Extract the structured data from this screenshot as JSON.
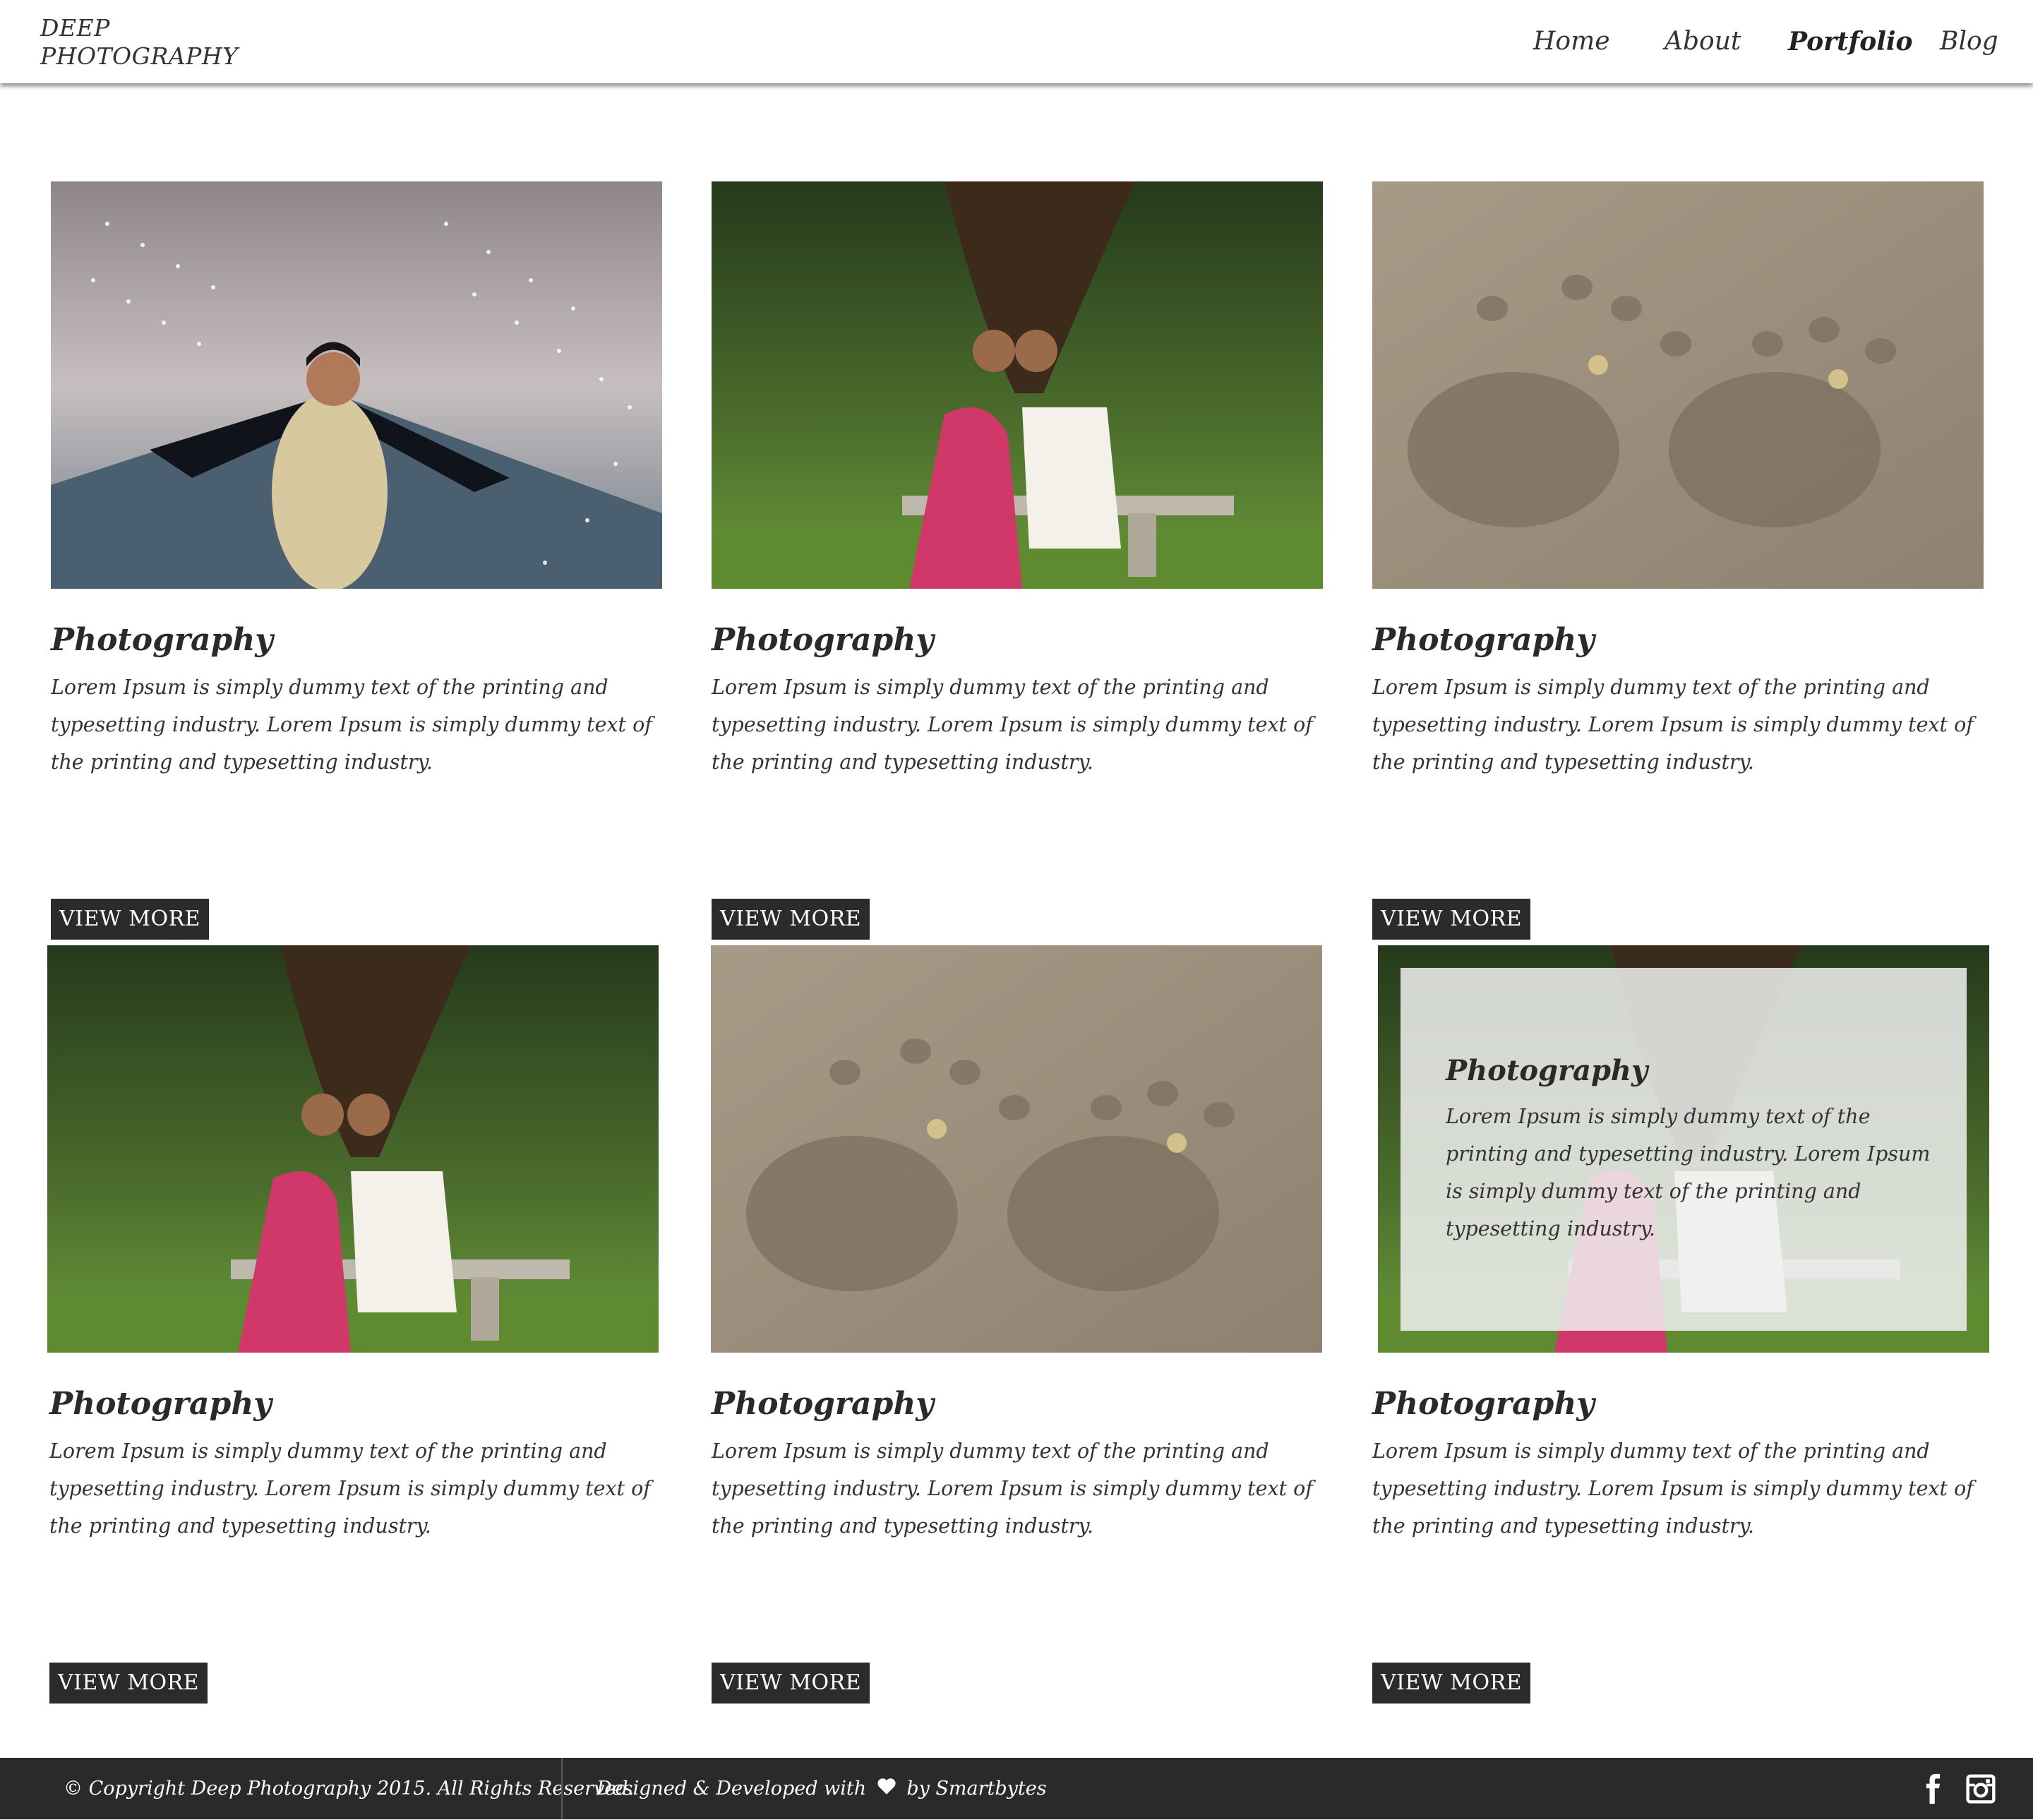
{
  "brand": {
    "logo_line1": "DEEP",
    "logo_line2": "PHOTOGRAPHY"
  },
  "nav": {
    "items": [
      {
        "label": "Home"
      },
      {
        "label": "About"
      },
      {
        "label": "Portfolio",
        "active": true
      },
      {
        "label": "Blog"
      }
    ]
  },
  "cards": [
    {
      "title": "Photography",
      "text": "Lorem Ipsum is simply dummy text of the printing and typesetting industry. Lorem Ipsum is simply dummy text of the printing and typesetting industry.",
      "button": "VIEW MORE",
      "image": "bride-under-lights-photo"
    },
    {
      "title": "Photography",
      "text": "Lorem Ipsum is simply dummy text of the printing and typesetting industry. Lorem Ipsum is simply dummy text of the printing and typesetting industry.",
      "button": "VIEW MORE",
      "image": "couple-on-bench-photo"
    },
    {
      "title": "Photography",
      "text": "Lorem Ipsum is simply dummy text of the printing and typesetting industry. Lorem Ipsum is simply dummy text of the printing and typesetting industry.",
      "button": "VIEW MORE",
      "image": "footprints-in-sand-photo"
    },
    {
      "title": "Photography",
      "text": "Lorem Ipsum is simply dummy text of the printing and typesetting industry. Lorem Ipsum is simply dummy text of the printing and typesetting industry.",
      "button": "VIEW MORE",
      "image": "couple-on-bench-photo"
    },
    {
      "title": "Photography",
      "text": "Lorem Ipsum is simply dummy text of the printing and typesetting industry. Lorem Ipsum is simply dummy text of the printing and typesetting industry.",
      "button": "VIEW MORE",
      "image": "footprints-in-sand-photo"
    },
    {
      "title": "Photography",
      "text": "Lorem Ipsum is simply dummy text of the printing and typesetting industry. Lorem Ipsum is simply dummy text of the printing and typesetting industry.",
      "button": "VIEW MORE",
      "image": "couple-on-bench-photo",
      "hover_overlay": {
        "title": "Photography",
        "text": "Lorem Ipsum is simply dummy text of the printing and typesetting industry. Lorem Ipsum is simply dummy text of the printing and typesetting industry."
      }
    }
  ],
  "footer": {
    "copyright": "© Copyright Deep Photography 2015. All Rights Reserved.",
    "credit_prefix": "Designed & Developed with",
    "credit_suffix": "by Smartbytes",
    "social": [
      "facebook-icon",
      "instagram-icon"
    ]
  },
  "colors": {
    "footer_bg": "#2a2a2a",
    "button_bg": "#2b2b2b",
    "text": "#333333"
  }
}
